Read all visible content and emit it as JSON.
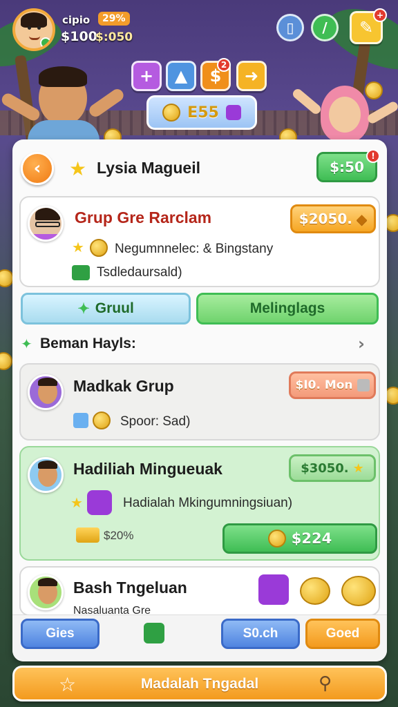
{
  "hud": {
    "player_name": "cipio",
    "level_badge": "29%",
    "balance": "$100",
    "secondary_balance": "$:050",
    "mystery_badge_count": "2",
    "alert_badge": "+"
  },
  "top_actions": {
    "add_label": "+",
    "dollar_badge": "2"
  },
  "currency_pill": {
    "amount": "E55"
  },
  "panel": {
    "title": "Lysia Magueil",
    "header_price": "$:50",
    "header_badge": "!",
    "featured": {
      "title": "Grup Gre Rarclam",
      "price": "$2050.",
      "line1": "Negumnnelec: & Bingstany",
      "line2": "Tsdledaursald)"
    },
    "tabs": {
      "left": "Gruul",
      "right": "Melinglags"
    },
    "section_title": "Beman Hayls:",
    "rows": [
      {
        "title": "Madkak Grup",
        "price": "$I0. Mon",
        "subtitle": "Spoor: Sad)"
      },
      {
        "title": "Hadiliah Minguеuak",
        "price": "$3050.",
        "subtitle": "Hadialah Mkingumningsiuan)",
        "gold_value": "$20%",
        "action_value": "$224"
      },
      {
        "title": "Bash Tngeluan",
        "subtitle": "Nasaluanta Gre"
      }
    ],
    "bottom_buttons": {
      "left": "Gies",
      "middle": "S0.ch",
      "right": "Goed"
    }
  },
  "footer": {
    "label": "Madalah Tngadal"
  },
  "colors": {
    "accent_orange": "#f39a1e",
    "accent_green": "#3fbd54",
    "title_red": "#b5261a"
  }
}
